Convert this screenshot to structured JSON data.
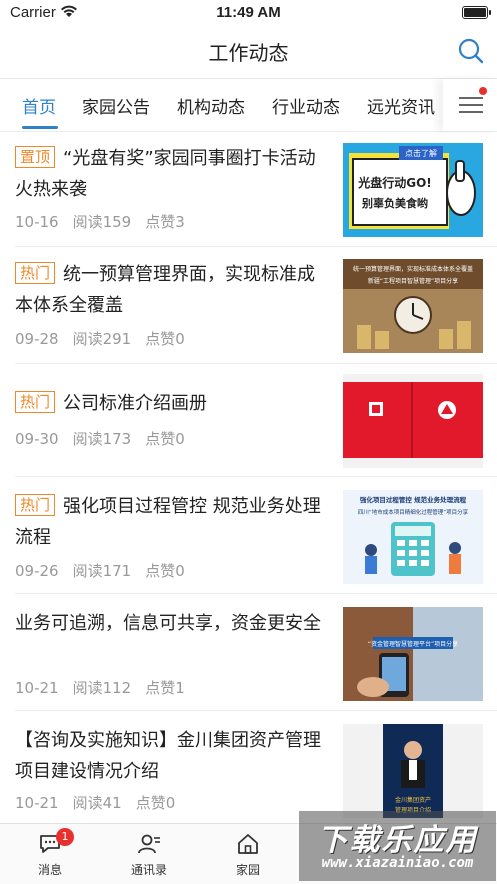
{
  "status_bar": {
    "carrier": "Carrier",
    "time": "11:49 AM"
  },
  "nav": {
    "title": "工作动态"
  },
  "tabs": [
    {
      "label": "首页"
    },
    {
      "label": "家园公告"
    },
    {
      "label": "机构动态"
    },
    {
      "label": "行业动态"
    },
    {
      "label": "远光资讯"
    }
  ],
  "articles": [
    {
      "tag": "置顶",
      "title": "“光盘有奖”家园同事圈打卡活动火热来袭",
      "date": "10-16",
      "reads": "阅读159",
      "likes": "点赞3",
      "thumb_text": [
        "点击了解",
        "光盘行动GO!",
        "别辜负美食哟"
      ]
    },
    {
      "tag": "热门",
      "title": "统一预算管理界面，实现标准成本体系全覆盖",
      "date": "09-28",
      "reads": "阅读291",
      "likes": "点赞0",
      "thumb_text": [
        "统一预算管理界面，实现标准成本体系全覆盖",
        "新疆“工程项目智慧管理”项目分享"
      ]
    },
    {
      "tag": "热门",
      "title": "公司标准介绍画册",
      "date": "09-30",
      "reads": "阅读173",
      "likes": "点赞0",
      "thumb_text": []
    },
    {
      "tag": "热门",
      "title": "强化项目过程管控  规范业务处理流程",
      "date": "09-26",
      "reads": "阅读171",
      "likes": "点赞0",
      "thumb_text": [
        "强化项目过程管控  规范业务处理流程",
        "四川“地市成本项目精细化过程管理”项目分享"
      ]
    },
    {
      "tag": "",
      "title": "业务可追溯，信息可共享，资金更安全",
      "date": "10-21",
      "reads": "阅读112",
      "likes": "点赞1",
      "thumb_text": [
        "“资金管理智慧管理平台”项目分享"
      ]
    },
    {
      "tag": "",
      "title": "【咨询及实施知识】金川集团资产管理项目建设情况介绍",
      "date": "10-21",
      "reads": "阅读41",
      "likes": "点赞0",
      "thumb_text": [
        "金川集团资产",
        "管理项目介绍"
      ]
    }
  ],
  "bottom_tabs": [
    {
      "label": "消息",
      "badge": "1"
    },
    {
      "label": "通讯录"
    },
    {
      "label": "家园"
    }
  ],
  "watermark": {
    "title": "下载乐应用",
    "url": "www.xiazainiao.com"
  },
  "colors": {
    "accent": "#2f82c8",
    "tag": "#ec8a2b",
    "badge": "#e8302f"
  }
}
